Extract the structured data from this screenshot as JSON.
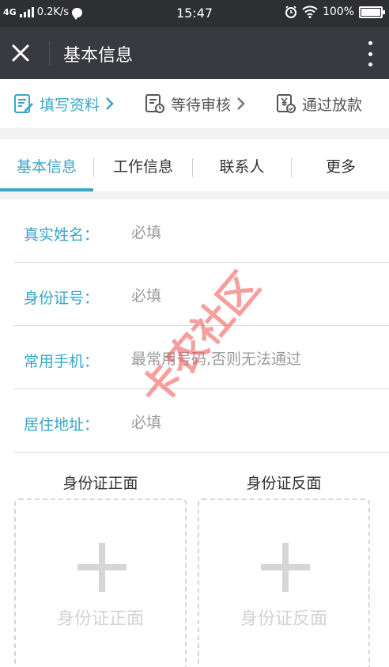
{
  "status_bar": {
    "network": "4G",
    "speed": "0.2K/s",
    "time": "15:47",
    "battery": "100%"
  },
  "titlebar": {
    "title": "基本信息",
    "close_icon": "close-icon",
    "more_icon": "more-vertical-icon"
  },
  "steps": [
    {
      "label": "填写资料",
      "icon": "edit-form-icon",
      "active": true
    },
    {
      "label": "等待审核",
      "icon": "clock-doc-icon",
      "active": false
    },
    {
      "label": "通过放款",
      "icon": "yen-doc-icon",
      "active": false
    }
  ],
  "tabs": [
    {
      "label": "基本信息",
      "active": true
    },
    {
      "label": "工作信息",
      "active": false
    },
    {
      "label": "联系人",
      "active": false
    },
    {
      "label": "更多",
      "active": false
    }
  ],
  "form": {
    "fields": [
      {
        "label": "真实姓名：",
        "placeholder": "必填",
        "value": ""
      },
      {
        "label": "身份证号：",
        "placeholder": "必填",
        "value": ""
      },
      {
        "label": "常用手机：",
        "placeholder": "最常用号码,否则无法通过",
        "value": ""
      },
      {
        "label": "居住地址：",
        "placeholder": "必填",
        "value": ""
      }
    ]
  },
  "uploads": [
    {
      "title": "身份证正面",
      "hint": "身份证正面"
    },
    {
      "title": "身份证反面",
      "hint": "身份证反面"
    }
  ],
  "watermark": "卡农社区",
  "colors": {
    "accent": "#3aa5c8",
    "titlebar": "#393a3f",
    "statusbar": "#2d2f33"
  }
}
